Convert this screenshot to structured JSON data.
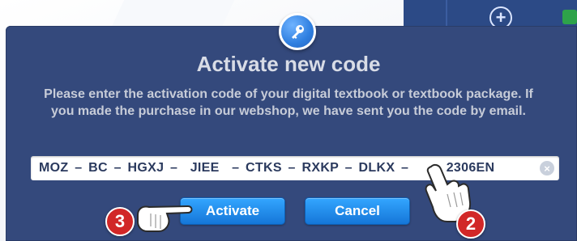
{
  "dialog": {
    "title": "Activate new code",
    "description": "Please enter the activation code of your digital textbook or textbook package. If you made the purchase in our webshop, we have sent you the code by email.",
    "code_value": "MOZ – BC – HGXJ –  JIEE  – CTKS – RXKP – DLKX –      2306EN",
    "activate_label": "Activate",
    "cancel_label": "Cancel",
    "clear_icon": "×"
  },
  "steps": {
    "activate_step": "3",
    "input_step": "2"
  },
  "background": {
    "plus_icon": "+"
  },
  "colors": {
    "dialog_bg": "#34497c",
    "button_blue": "#1f8ae8",
    "marker_red": "#d12727",
    "title_text": "#d8dce6"
  },
  "icons": [
    "key-icon",
    "clear-icon",
    "plus-icon",
    "pointing-hand-icon"
  ]
}
